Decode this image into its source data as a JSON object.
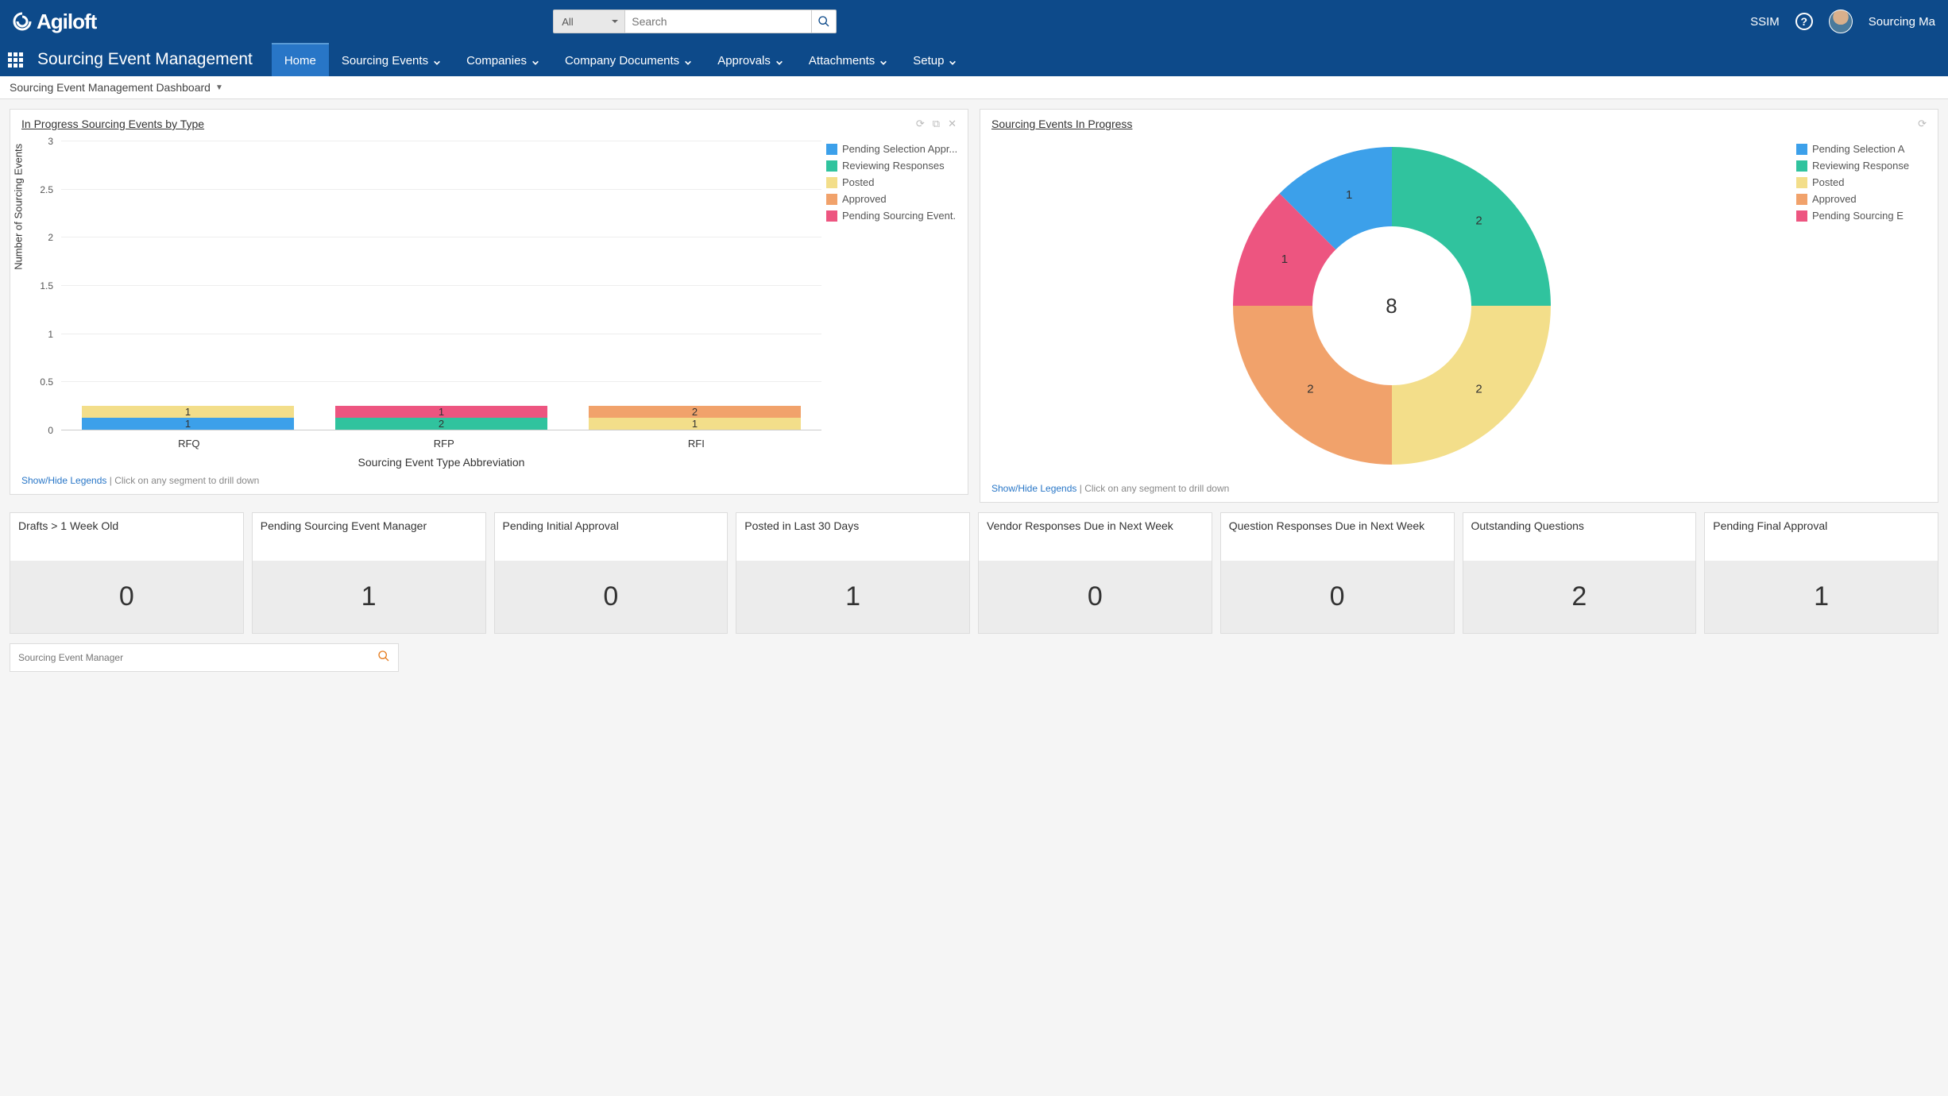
{
  "brand": "Agiloft",
  "search": {
    "scope": "All",
    "placeholder": "Search"
  },
  "header_right": {
    "ssim": "SSIM",
    "username": "Sourcing Ma"
  },
  "app_title": "Sourcing Event Management",
  "nav": [
    {
      "label": "Home",
      "active": true,
      "dropdown": false
    },
    {
      "label": "Sourcing Events",
      "active": false,
      "dropdown": true
    },
    {
      "label": "Companies",
      "active": false,
      "dropdown": true
    },
    {
      "label": "Company Documents",
      "active": false,
      "dropdown": true
    },
    {
      "label": "Approvals",
      "active": false,
      "dropdown": true
    },
    {
      "label": "Attachments",
      "active": false,
      "dropdown": true
    },
    {
      "label": "Setup",
      "active": false,
      "dropdown": true
    }
  ],
  "breadcrumb": "Sourcing Event Management Dashboard",
  "left_panel": {
    "title": "In Progress Sourcing Events by Type",
    "footer_link": "Show/Hide Legends",
    "footer_text": " | Click on any segment to drill down"
  },
  "right_panel": {
    "title": "Sourcing Events In Progress",
    "footer_link": "Show/Hide Legends",
    "footer_text": " | Click on any segment to drill down",
    "center_total": "8"
  },
  "legend": [
    {
      "label": "Pending Selection Appr...",
      "color": "c-blue"
    },
    {
      "label": "Reviewing Responses",
      "color": "c-green"
    },
    {
      "label": "Posted",
      "color": "c-yellow"
    },
    {
      "label": "Approved",
      "color": "c-orange"
    },
    {
      "label": "Pending Sourcing Event...",
      "color": "c-pink"
    }
  ],
  "legend_right": [
    {
      "label": "Pending Selection A",
      "color": "c-blue"
    },
    {
      "label": "Reviewing Response",
      "color": "c-green"
    },
    {
      "label": "Posted",
      "color": "c-yellow"
    },
    {
      "label": "Approved",
      "color": "c-orange"
    },
    {
      "label": "Pending Sourcing E",
      "color": "c-pink"
    }
  ],
  "kpi_left": [
    {
      "label": "Drafts > 1 Week Old",
      "value": "0"
    },
    {
      "label": "Pending Sourcing Event Manager",
      "value": "1"
    },
    {
      "label": "Pending Initial Approval",
      "value": "0"
    },
    {
      "label": "Posted in Last 30 Days",
      "value": "1"
    }
  ],
  "kpi_right": [
    {
      "label": "Vendor Responses Due in Next Week",
      "value": "0"
    },
    {
      "label": "Question Responses Due in Next Week",
      "value": "0"
    },
    {
      "label": "Outstanding Questions",
      "value": "2"
    },
    {
      "label": "Pending Final Approval",
      "value": "1"
    }
  ],
  "bottom_search_placeholder": "Sourcing Event Manager",
  "chart_data": [
    {
      "type": "bar",
      "title": "In Progress Sourcing Events by Type",
      "xlabel": "Sourcing Event Type Abbreviation",
      "ylabel": "Number of Sourcing Events",
      "ylim": [
        0,
        3
      ],
      "yticks": [
        0,
        0.5,
        1,
        1.5,
        2,
        2.5,
        3
      ],
      "categories": [
        "RFQ",
        "RFP",
        "RFI"
      ],
      "series": [
        {
          "name": "Pending Selection Appr...",
          "color": "c-blue",
          "values": [
            1,
            0,
            0
          ]
        },
        {
          "name": "Reviewing Responses",
          "color": "c-green",
          "values": [
            0,
            2,
            0
          ]
        },
        {
          "name": "Posted",
          "color": "c-yellow",
          "values": [
            1,
            0,
            1
          ]
        },
        {
          "name": "Approved",
          "color": "c-orange",
          "values": [
            0,
            0,
            2
          ]
        },
        {
          "name": "Pending Sourcing Event...",
          "color": "c-pink",
          "values": [
            0,
            1,
            0
          ]
        }
      ]
    },
    {
      "type": "pie",
      "title": "Sourcing Events In Progress",
      "total": 8,
      "series": [
        {
          "name": "Pending Selection Approval",
          "color": "c-blue",
          "value": 1
        },
        {
          "name": "Reviewing Responses",
          "color": "c-green",
          "value": 2
        },
        {
          "name": "Posted",
          "color": "c-yellow",
          "value": 2
        },
        {
          "name": "Approved",
          "color": "c-orange",
          "value": 2
        },
        {
          "name": "Pending Sourcing Event",
          "color": "c-pink",
          "value": 1
        }
      ]
    }
  ]
}
